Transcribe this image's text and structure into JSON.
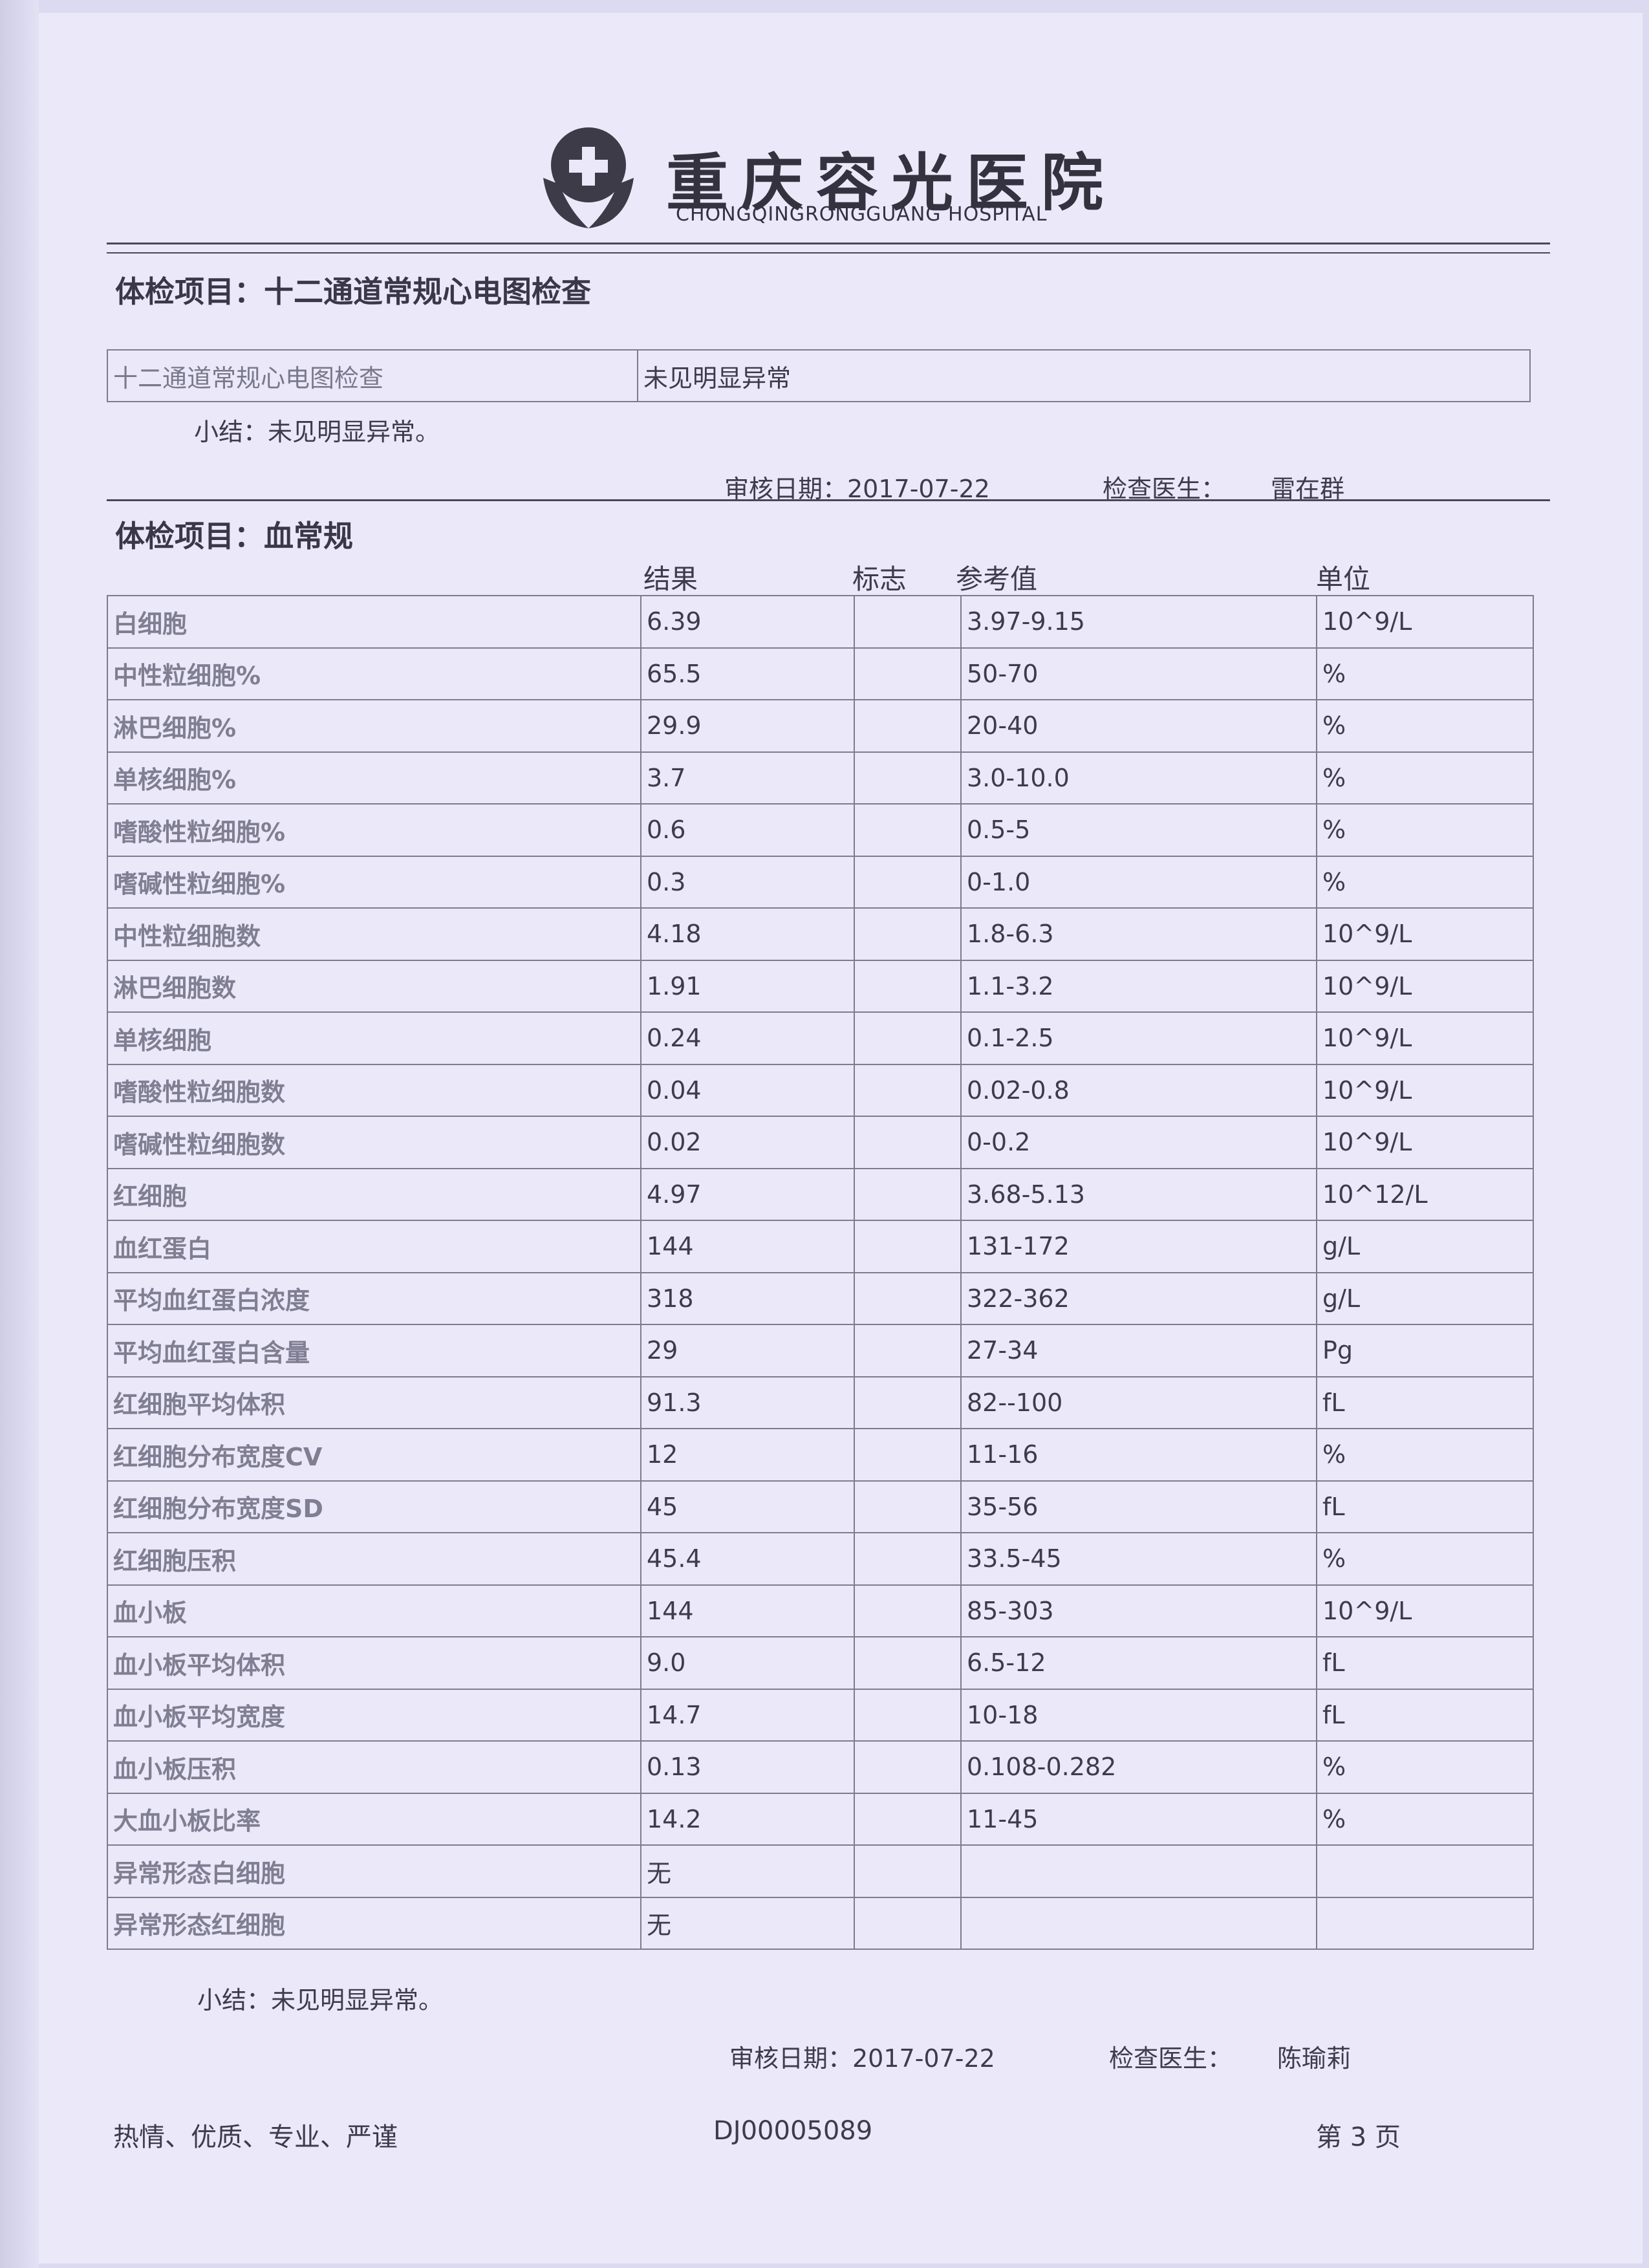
{
  "header": {
    "hospital_cn": "重庆容光医院",
    "hospital_en": "CHONGQINGRONGGUANG HOSPITAL"
  },
  "ecg": {
    "title": "体检项目：十二通道常规心电图检查",
    "item": "十二通道常规心电图检查",
    "result": "未见明显异常",
    "summary": "小结：未见明显异常。",
    "review_date": "审核日期：2017-07-22",
    "doctor_label": "检查医生：",
    "doctor": "雷在群"
  },
  "blood": {
    "title": "体检项目：血常规",
    "columns": {
      "result": "结果",
      "flag": "标志",
      "reference": "参考值",
      "unit": "单位"
    },
    "rows": [
      {
        "name": "白细胞",
        "result": "6.39",
        "flag": "",
        "ref": "3.97-9.15",
        "unit": "10^9/L"
      },
      {
        "name": "中性粒细胞%",
        "result": "65.5",
        "flag": "",
        "ref": "50-70",
        "unit": "%"
      },
      {
        "name": "淋巴细胞%",
        "result": "29.9",
        "flag": "",
        "ref": "20-40",
        "unit": "%"
      },
      {
        "name": "单核细胞%",
        "result": "3.7",
        "flag": "",
        "ref": "3.0-10.0",
        "unit": "%"
      },
      {
        "name": "嗜酸性粒细胞%",
        "result": "0.6",
        "flag": "",
        "ref": "0.5-5",
        "unit": "%"
      },
      {
        "name": "嗜碱性粒细胞%",
        "result": "0.3",
        "flag": "",
        "ref": "0-1.0",
        "unit": "%"
      },
      {
        "name": "中性粒细胞数",
        "result": "4.18",
        "flag": "",
        "ref": "1.8-6.3",
        "unit": "10^9/L"
      },
      {
        "name": "淋巴细胞数",
        "result": "1.91",
        "flag": "",
        "ref": "1.1-3.2",
        "unit": "10^9/L"
      },
      {
        "name": "单核细胞",
        "result": "0.24",
        "flag": "",
        "ref": "0.1-2.5",
        "unit": "10^9/L"
      },
      {
        "name": "嗜酸性粒细胞数",
        "result": "0.04",
        "flag": "",
        "ref": "0.02-0.8",
        "unit": "10^9/L"
      },
      {
        "name": "嗜碱性粒细胞数",
        "result": "0.02",
        "flag": "",
        "ref": "0-0.2",
        "unit": "10^9/L"
      },
      {
        "name": "红细胞",
        "result": "4.97",
        "flag": "",
        "ref": "3.68-5.13",
        "unit": "10^12/L"
      },
      {
        "name": "血红蛋白",
        "result": "144",
        "flag": "",
        "ref": "131-172",
        "unit": "g/L"
      },
      {
        "name": "平均血红蛋白浓度",
        "result": "318",
        "flag": "",
        "ref": "322-362",
        "unit": "g/L"
      },
      {
        "name": "平均血红蛋白含量",
        "result": "29",
        "flag": "",
        "ref": "27-34",
        "unit": "Pg"
      },
      {
        "name": "红细胞平均体积",
        "result": "91.3",
        "flag": "",
        "ref": "82--100",
        "unit": "fL"
      },
      {
        "name": "红细胞分布宽度CV",
        "result": "12",
        "flag": "",
        "ref": "11-16",
        "unit": "%"
      },
      {
        "name": "红细胞分布宽度SD",
        "result": "45",
        "flag": "",
        "ref": "35-56",
        "unit": "fL"
      },
      {
        "name": "红细胞压积",
        "result": "45.4",
        "flag": "",
        "ref": "33.5-45",
        "unit": "%"
      },
      {
        "name": "血小板",
        "result": "144",
        "flag": "",
        "ref": "85-303",
        "unit": "10^9/L"
      },
      {
        "name": "血小板平均体积",
        "result": "9.0",
        "flag": "",
        "ref": "6.5-12",
        "unit": "fL"
      },
      {
        "name": "血小板平均宽度",
        "result": "14.7",
        "flag": "",
        "ref": "10-18",
        "unit": "fL"
      },
      {
        "name": "血小板压积",
        "result": "0.13",
        "flag": "",
        "ref": "0.108-0.282",
        "unit": "%"
      },
      {
        "name": "大血小板比率",
        "result": "14.2",
        "flag": "",
        "ref": "11-45",
        "unit": "%"
      },
      {
        "name": "异常形态白细胞",
        "result": "无",
        "flag": "",
        "ref": "",
        "unit": ""
      },
      {
        "name": "异常形态红细胞",
        "result": "无",
        "flag": "",
        "ref": "",
        "unit": ""
      }
    ],
    "summary": "小结：未见明显异常。",
    "review_date": "审核日期：2017-07-22",
    "doctor_label": "检查医生：",
    "doctor": "陈瑜莉"
  },
  "footer": {
    "motto": "热情、优质、专业、严谨",
    "code": "DJ00005089",
    "page": "第 3 页"
  }
}
